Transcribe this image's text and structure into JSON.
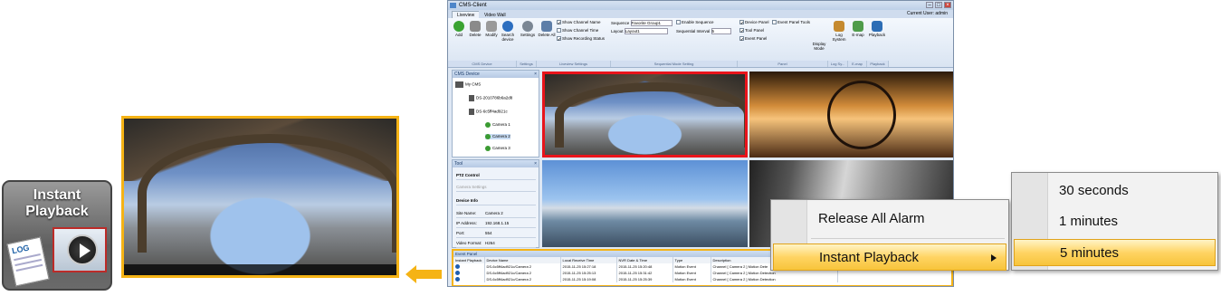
{
  "icon_tile": {
    "line1": "Instant",
    "line2": "Playback",
    "log_label": "LOG"
  },
  "window": {
    "title": "CMS-Client",
    "tabs": [
      "Liveview",
      "Video Wall"
    ],
    "current_user": "Current User: admin",
    "ribbon": {
      "buttons": [
        {
          "label": "Add",
          "color": "#3aa332"
        },
        {
          "label": "Delete",
          "color": "#8a8a8a"
        },
        {
          "label": "Modify",
          "color": "#8a8a8a"
        },
        {
          "label": "Search device",
          "color": "#2d6fc0"
        },
        {
          "label": "Settings",
          "color": "#7b8794"
        },
        {
          "label": "Delete All",
          "color": "#5d7ea8"
        }
      ],
      "groups": [
        "CMS Device",
        "Settings",
        "Liveview Settings",
        "Sequential Mode Setting",
        "Panel",
        "Log Sy...",
        "E-map",
        "Playback"
      ],
      "liveview_checks": [
        "Show Channel Name",
        "Show Channel Time",
        "Show Recording Status"
      ],
      "sequence_label": "Sequence",
      "sequence_value": "Favorite Group1",
      "layout_label": "Layout",
      "layout_value": "Layout1",
      "enable_sequence": "Enable Sequence",
      "interval_label": "Sequential Interval",
      "interval_value": "5",
      "panel_checks": [
        "Device Panel",
        "Tool Panel",
        "Event Panel"
      ],
      "event_panel_tools": "Event Panel Tools",
      "display_mode": "Display Mode",
      "log_system": "Log System",
      "emap": "E-map",
      "playback": "Playback"
    },
    "device_panel": {
      "title": "CMS Device",
      "root": "My CMS",
      "devices": [
        "DS-2010786b6a2d8",
        "DS-6c5ff4ad921c"
      ],
      "cameras": [
        "Camera 1",
        "Camera 2",
        "Camera 3"
      ]
    },
    "tool_panel": {
      "title": "Tool",
      "ptz": "PTZ Control",
      "camera_settings": "Camera Settings",
      "device_info": "Device Info",
      "rows": [
        {
          "k": "Site Name:",
          "v": "Camera 2"
        },
        {
          "k": "IP Address:",
          "v": "192.168.1.15"
        },
        {
          "k": "Port:",
          "v": "554"
        },
        {
          "k": "Video Format:",
          "v": "H264"
        }
      ]
    },
    "event_panel": {
      "title": "Event Panel",
      "headers": [
        "Instant Playback",
        "Device Name",
        "Local Receive Time",
        "NVR Date & Time",
        "Type",
        "Description"
      ],
      "rows": [
        [
          "DS-6c5ff4ad921c/Camera 2",
          "2015-11-25 15:27:18",
          "2015-11-25 15:20:48",
          "Motion Event",
          "Channel [ Camera 2 ] Motion Dete"
        ],
        [
          "DS-6c5ff4ad921c/Camera 2",
          "2015-11-25 15:25:13",
          "2015-11-25 15:31:42",
          "Motion Event",
          "Channel [ Camera 2 ] Motion Detection"
        ],
        [
          "DS-6c5ff4ad921c/Camera 2",
          "2015-11-25 15:19:08",
          "2015-11-25 15:25:39",
          "Motion Event",
          "Channel [ Camera 2 ] Motion Detection"
        ]
      ]
    }
  },
  "context_menu": {
    "items": [
      "Release All Alarm",
      "Instant Playback"
    ]
  },
  "submenu": {
    "items": [
      "30 seconds",
      "1 minutes",
      "5 minutes"
    ]
  },
  "colors": {
    "highlight": "#f5b315",
    "selected_border": "#e8141b",
    "menu_highlight": "#ffd463"
  }
}
